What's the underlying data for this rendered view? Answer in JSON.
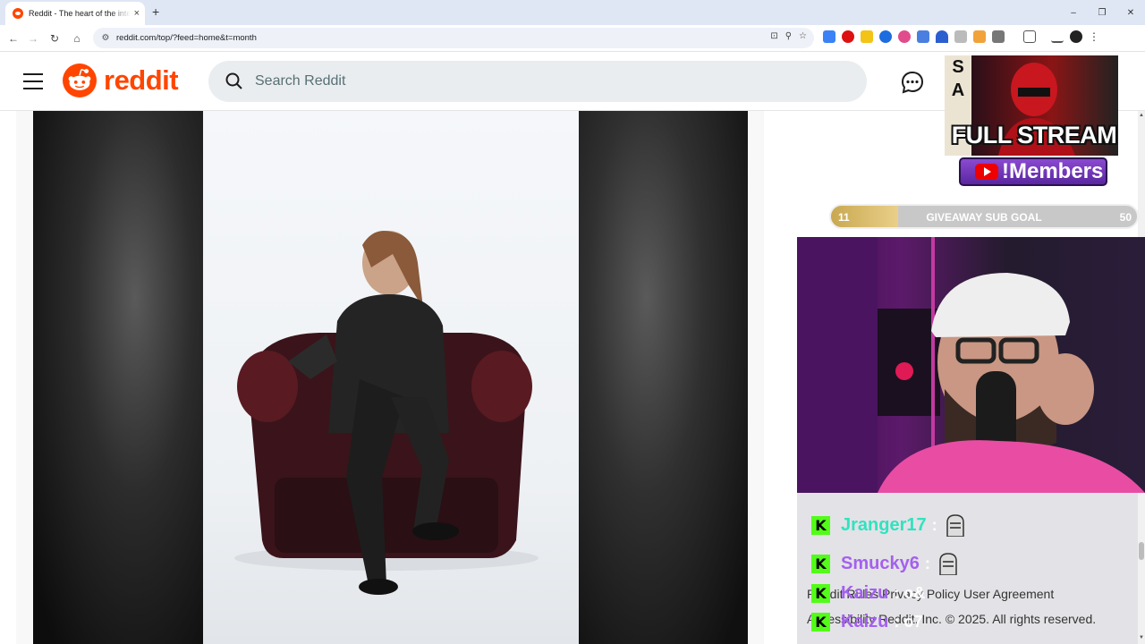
{
  "browser": {
    "tab_title": "Reddit - The heart of the internet",
    "tab_close": "×",
    "new_tab": "+",
    "url": "reddit.com/top/?feed=home&t=month",
    "window_controls": [
      "–",
      "❐",
      "✕"
    ]
  },
  "header": {
    "wordmark": "reddit",
    "search_placeholder": "Search Reddit",
    "icons": [
      "hamburger-icon",
      "search-icon",
      "chat-icon"
    ]
  },
  "colors": {
    "reddit_orange": "#ff4500",
    "kick_green": "#53fc18",
    "chat_user_teal": "#2fe3c0",
    "chat_user_purple": "#a460ee",
    "goal_fill": "#d9bc6c"
  },
  "overlay": {
    "tier_letters": [
      "S",
      "A"
    ],
    "promo_title": "FULL STREAM",
    "members_label": "!Members",
    "goal": {
      "label": "GIVEAWAY SUB GOAL",
      "start": "11",
      "end": "50",
      "progress_fraction": 0.22
    }
  },
  "chat": {
    "messages": [
      {
        "user": "Jranger17",
        "sep": ":",
        "color": "#2fe3c0"
      },
      {
        "user": "Smucky6",
        "sep": ":",
        "color": "#a460ee"
      },
      {
        "user": "Kaizu",
        "sep": ": o&",
        "color": "#a460ee"
      },
      {
        "user": "Kaizu",
        "sep": ": o7",
        "color": "#a460ee"
      }
    ],
    "badge": "K"
  },
  "footer": {
    "line1": "Reddit Rules   Privacy Policy   User Agreement",
    "line2": "Accessibility   Reddit, Inc. © 2025. All rights reserved."
  }
}
